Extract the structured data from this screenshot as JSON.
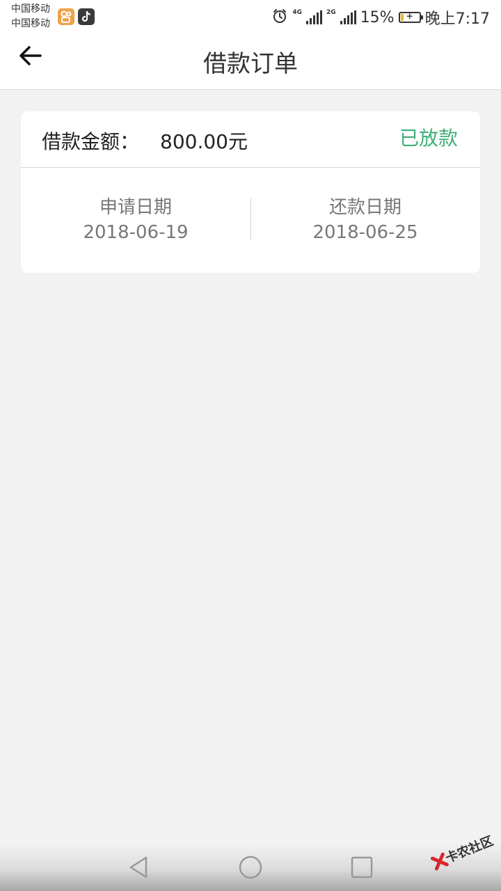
{
  "status_bar": {
    "carrier_1": "中国移动",
    "carrier_2": "中国移动",
    "network_1": "4G",
    "network_2": "2G",
    "battery_percent": "15%",
    "battery_level": 0.15,
    "time": "晚上7:17",
    "icons": [
      "kuaishou-app-icon",
      "tiktok-app-icon",
      "alarm-icon",
      "signal-icon",
      "battery-charging-icon"
    ]
  },
  "header": {
    "title": "借款订单",
    "back_icon": "arrow-left-icon"
  },
  "order": {
    "amount_label": "借款金额：",
    "amount_value": "800.00元",
    "status": "已放款",
    "status_color": "#3faf76",
    "apply_date_label": "申请日期",
    "apply_date": "2018-06-19",
    "repay_date_label": "还款日期",
    "repay_date": "2018-06-25"
  },
  "watermark": {
    "text": "卡农社区"
  },
  "nav_bar": {
    "icons": [
      "nav-back-icon",
      "nav-home-icon",
      "nav-recent-icon"
    ]
  }
}
